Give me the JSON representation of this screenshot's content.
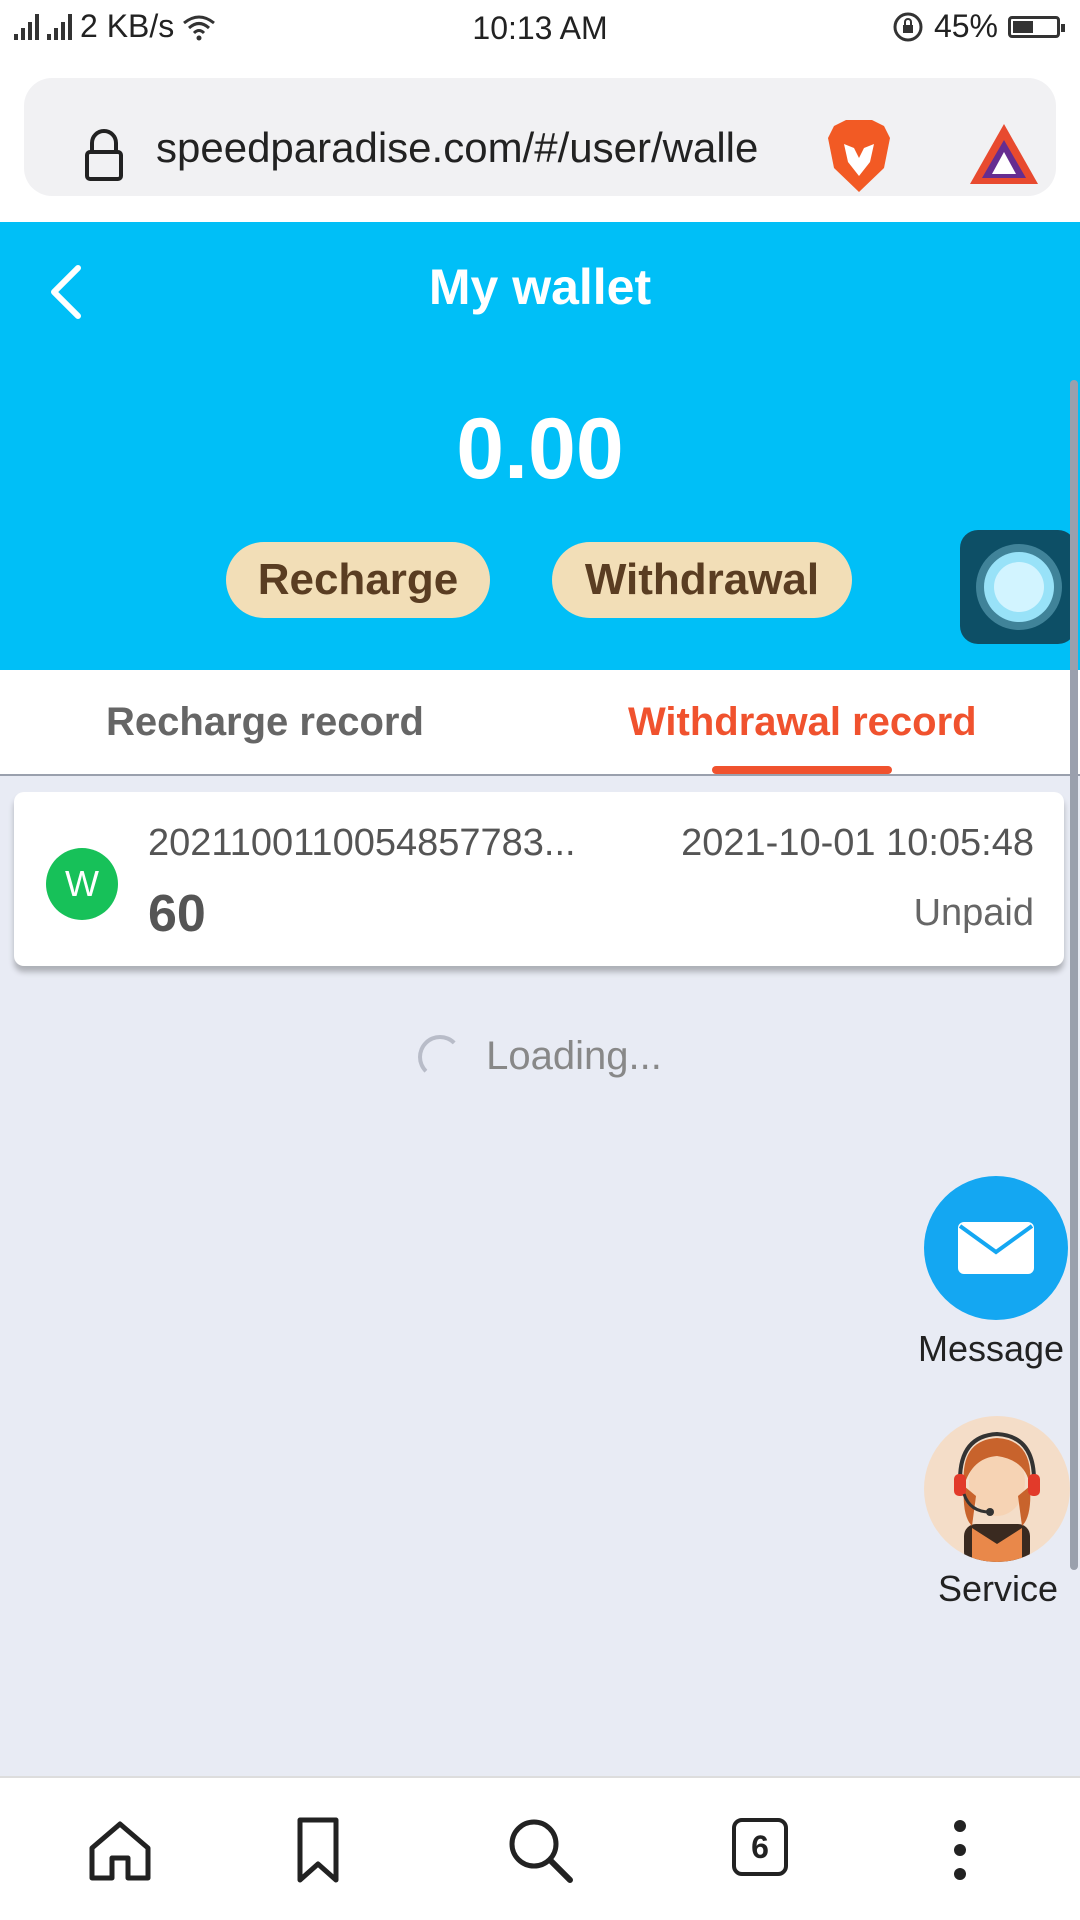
{
  "status_bar": {
    "speed": "2 KB/s",
    "time": "10:13 AM",
    "battery": "45%"
  },
  "browser": {
    "url": "speedparadise.com/#/user/walle",
    "tab_count": "6"
  },
  "header": {
    "title": "My wallet",
    "balance": "0.00",
    "recharge_label": "Recharge",
    "withdrawal_label": "Withdrawal"
  },
  "tabs": [
    {
      "label": "Recharge record",
      "active": false
    },
    {
      "label": "Withdrawal record",
      "active": true
    }
  ],
  "records": [
    {
      "badge": "W",
      "order_no": "2021100110054857783...",
      "time": "2021-10-01 10:05:48",
      "amount": "60",
      "status": "Unpaid"
    }
  ],
  "loading_text": "Loading...",
  "side_buttons": {
    "message_label": "Message",
    "service_label": "Service"
  },
  "colors": {
    "header_bg": "#00bff7",
    "accent": "#f0522e",
    "pill_bg": "#f2deb7",
    "badge_green": "#17c159"
  }
}
